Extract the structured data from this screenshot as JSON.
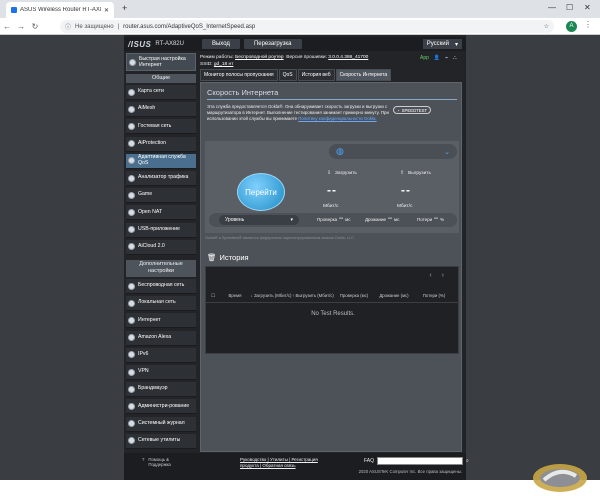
{
  "browser": {
    "tab_title": "ASUS Wireless Router RT-AX82...",
    "new_tab": "+",
    "url_security": "Не защищено",
    "url_sep": "|",
    "url": "router.asus.com/AdaptiveQoS_InternetSpeed.asp",
    "avatar": "A"
  },
  "router": {
    "logo": "/ISUS",
    "model": "RT-AX82U",
    "logout": "Выход",
    "reboot": "Перезагрузка",
    "language": "Русский",
    "quick_setup": "Быстрая настройка Интернет",
    "status": {
      "mode_label": "Режим работы:",
      "mode_value": "Беспроводной роутер",
      "fw_label": "Версия прошивки:",
      "fw_value": "3.0.0.4.386_41700",
      "ssid_label": "SSID:",
      "ssid_value": "gd_18 нт",
      "app": "App"
    },
    "sidebar": {
      "general_header": "Общие",
      "general": [
        {
          "label": "Карта сети"
        },
        {
          "label": "AiMesh"
        },
        {
          "label": "Гостевая сеть"
        },
        {
          "label": "AiProtection"
        },
        {
          "label": "Адаптивная служба QoS"
        },
        {
          "label": "Анализатор трафика"
        },
        {
          "label": "Game"
        },
        {
          "label": "Open NAT"
        },
        {
          "label": "USB-приложение"
        },
        {
          "label": "AiCloud 2.0"
        }
      ],
      "advanced_header": "Дополнительные настройки",
      "advanced": [
        {
          "label": "Беспроводная сеть"
        },
        {
          "label": "Локальная сеть"
        },
        {
          "label": "Интернет"
        },
        {
          "label": "Amazon Alexa"
        },
        {
          "label": "IPv6"
        },
        {
          "label": "VPN"
        },
        {
          "label": "Брандмауэр"
        },
        {
          "label": "Администри-рование"
        },
        {
          "label": "Системный журнал"
        },
        {
          "label": "Сетевые утилиты"
        }
      ]
    },
    "tabs": [
      {
        "label": "Монитор полосы пропускания"
      },
      {
        "label": "QoS"
      },
      {
        "label": "История веб"
      },
      {
        "label": "Скорость Интернета"
      }
    ],
    "page_title": "Скорость Интернета",
    "info_text": "Эта служба предоставляется Ookla®. Она обнаруживает скорость загрузки и выгрузки с маршрутизатора в Интернет. Выполнение тестирования занимает примерно минуту. При использовании этой службы вы принимаете",
    "info_link": "Политику конфиденциальности Ookla.",
    "ookla_badge": "SPEEDTEST",
    "go_button": "Перейти",
    "download_label": "Загрузить",
    "upload_label": "Выгрузить",
    "download_value": "--",
    "upload_value": "--",
    "unit": "Мбит/с",
    "unit_select": "Уровень",
    "ping_label": "Проверка",
    "ping_value": "--",
    "ping_unit": "мс",
    "jitter_label": "Дрожание",
    "jitter_value": "--",
    "jitter_unit": "мс",
    "loss_label": "Потери",
    "loss_value": "--",
    "loss_unit": "%",
    "disclaimer": "Ookla® и Speedtest® является федерально зарегистрированным знаком Ookla, LLC.",
    "history_title": "История",
    "history_headers": [
      "",
      "Время",
      "↓ Загрузить (Мбит/с)",
      "↑ Выгрузить (Мбит/с)",
      "Проверка (мс)",
      "Дрожание (мс)",
      "Потери (%)"
    ],
    "no_results": "No Test Results.",
    "footer": {
      "help": "Помощь & Поддержка",
      "links_line1": "Руководство | Утилиты | Регистрация",
      "links_line2": "продукта | Обратная связь",
      "faq": "FAQ",
      "copyright": "2020 ASUSTeK Computer Inc. Все права защищены."
    }
  },
  "colors": {
    "accent": "#4aa6ff",
    "selected": "#4a6f8e",
    "background": "#222427"
  }
}
